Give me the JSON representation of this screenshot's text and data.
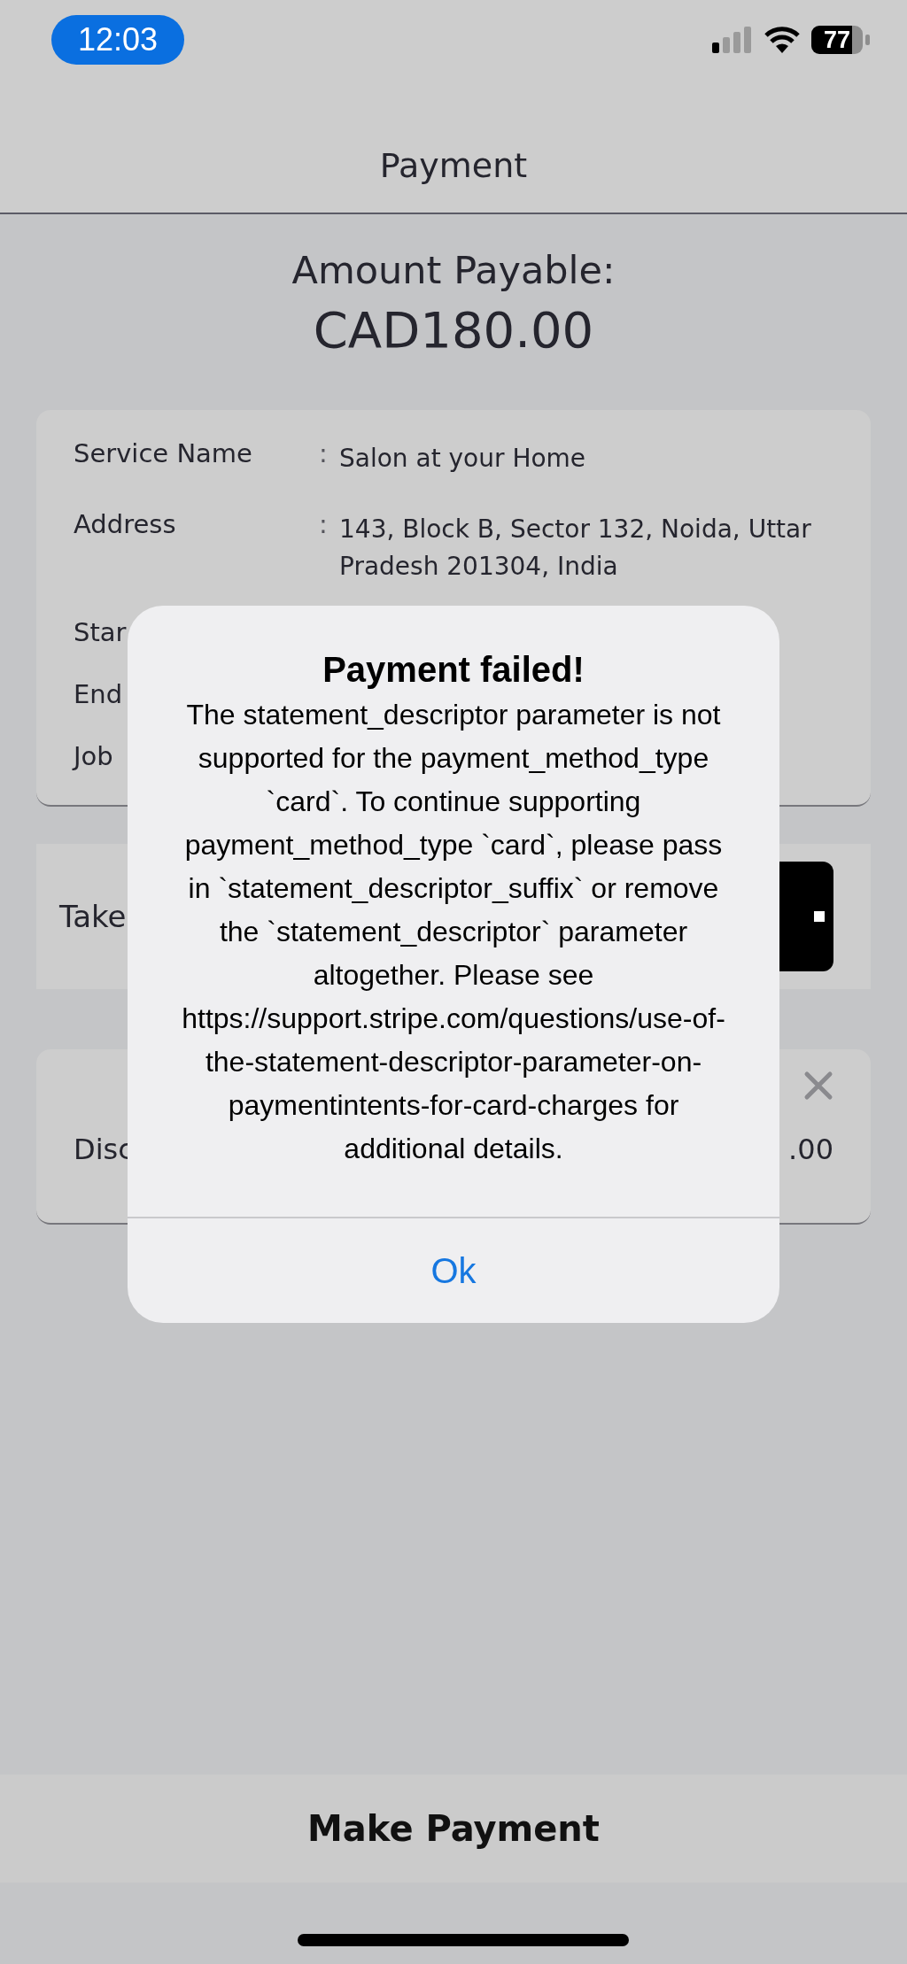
{
  "status_bar": {
    "time": "12:03",
    "battery": "77"
  },
  "header": {
    "title": "Payment"
  },
  "amount": {
    "label": "Amount Payable:",
    "value": "CAD180.00"
  },
  "details": [
    {
      "label": "Service Name",
      "separator": ":",
      "value": "Salon at your Home"
    },
    {
      "label": "Address",
      "separator": ":",
      "value": "143, Block B, Sector 132, Noida, Uttar Pradesh 201304, India"
    },
    {
      "label": "Star"
    },
    {
      "label": "End"
    },
    {
      "label": "Job"
    }
  ],
  "tip_card": {
    "label": "Take"
  },
  "discount_card": {
    "label": "Disc",
    "value": ".00"
  },
  "dialog": {
    "title": "Payment failed!",
    "message": "The statement_descriptor parameter is not supported for the payment_method_type `card`. To continue supporting payment_method_type `card`, please pass in `statement_descriptor_suffix` or remove the `statement_descriptor` parameter altogether. Please see https://support.stripe.com/questions/use-of-the-statement-descriptor-parameter-on-paymentintents-for-card-charges for additional details.",
    "button": "Ok"
  },
  "footer": {
    "button": "Make Payment"
  }
}
